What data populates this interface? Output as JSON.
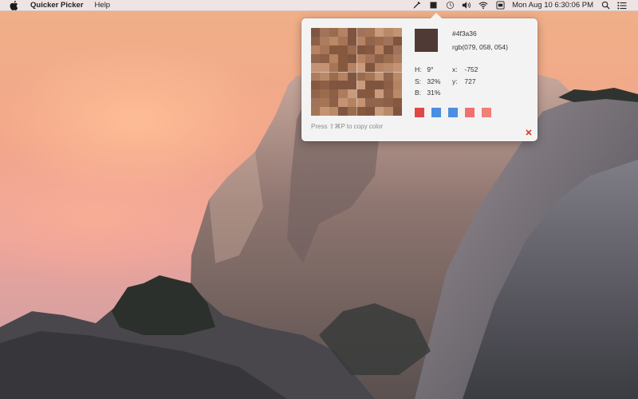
{
  "menubar": {
    "app_name": "Quicker Picker",
    "menus": [
      "Help"
    ],
    "clock": "Mon Aug 10  6:30:06 PM",
    "status_icons": [
      "eyedropper-icon",
      "stop-icon",
      "time-machine-icon",
      "volume-icon",
      "wifi-icon",
      "user-badge-icon",
      "spotlight-icon",
      "notification-center-icon"
    ]
  },
  "picker": {
    "hex": "#4f3a36",
    "rgb": "rgb(079, 058, 054)",
    "hsb": [
      {
        "label": "H:",
        "value": "9°"
      },
      {
        "label": "S:",
        "value": "32%"
      },
      {
        "label": "B:",
        "value": "31%"
      }
    ],
    "coords": [
      {
        "label": "x:",
        "value": "-752"
      },
      {
        "label": "y:",
        "value": "727"
      }
    ],
    "hint": "Press ⇧⌘P to copy color",
    "history_colors": [
      "#e04848",
      "#4a8fe0",
      "#4a8fe0",
      "#f07070",
      "#f08078"
    ],
    "selected_color": "#4f3a36"
  }
}
